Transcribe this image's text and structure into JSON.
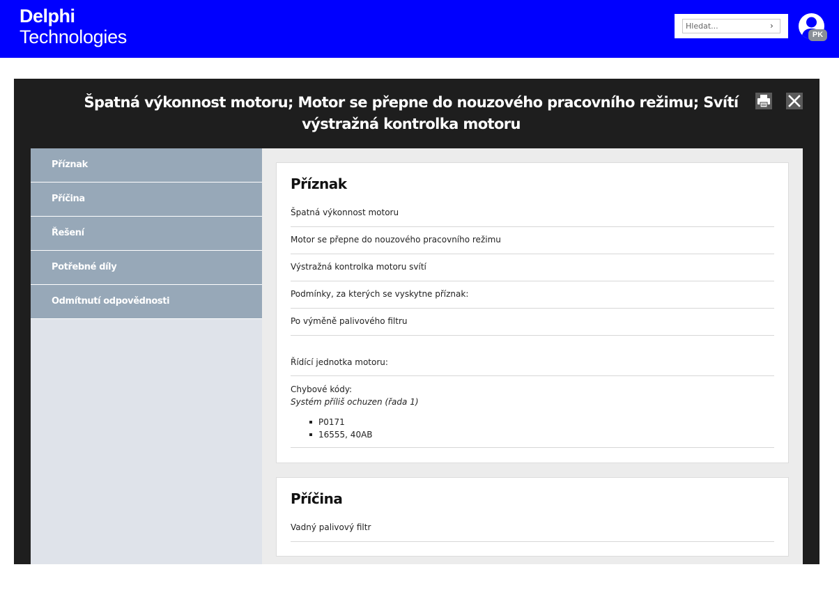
{
  "header": {
    "brand_line1": "Delphi",
    "brand_line2": "Technologies",
    "search_placeholder": "Hledat...",
    "search_chevron": "›",
    "user_initials": "PK",
    "color_header": "#0000ff"
  },
  "modal": {
    "title": "Špatná výkonnost motoru; Motor se přepne do nouzového pracovního režimu; Svítí výstražná kontrolka motoru",
    "print_icon": "print-icon",
    "close_icon": "close-icon"
  },
  "sidebar": {
    "items": [
      {
        "label": "Příznak"
      },
      {
        "label": "Příčina"
      },
      {
        "label": "Řešení"
      },
      {
        "label": "Potřebné díly"
      },
      {
        "label": "Odmítnutí odpovědnosti"
      }
    ]
  },
  "symptom_section": {
    "heading": "Příznak",
    "rows": [
      "Špatná výkonnost motoru",
      "Motor se přepne do nouzového pracovního režimu",
      "Výstražná kontrolka motoru svítí",
      "Podmínky, za kterých se vyskytne příznak:",
      "Po výměně palivového filtru",
      "Řídící jednotka motoru:"
    ],
    "error_codes_label": "Chybové kódy:",
    "error_description": "Systém příliš ochuzen (řada 1)",
    "codes": [
      "P0171",
      "16555, 40AB"
    ]
  },
  "cause_section": {
    "heading": "Příčina",
    "rows": [
      "Vadný palivový filtr"
    ]
  }
}
